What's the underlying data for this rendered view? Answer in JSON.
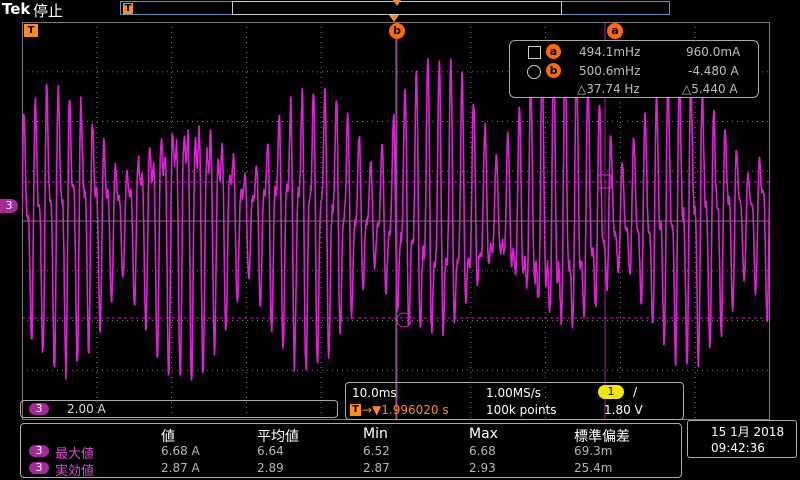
{
  "topbar": {
    "brand": "Tek",
    "state": "停止",
    "trigger_marker": "T"
  },
  "markers": {
    "trigger_T": "T",
    "cursor_a": "a",
    "cursor_b": "b",
    "channel": "3"
  },
  "cursor_readout": {
    "a_label": "a",
    "a_freq": "494.1mHz",
    "a_value": "960.0mA",
    "b_label": "b",
    "b_freq": "500.6mHz",
    "b_value": "-4.480 A",
    "delta_freq": "△37.74 Hz",
    "delta_value": "△5.440 A"
  },
  "channel_scale": {
    "channel": "3",
    "scale": "2.00 A"
  },
  "horizontal": {
    "timebase": "10.0ms",
    "sample_rate": "1.00MS/s",
    "trigger_source": "1",
    "trigger_slope": "/",
    "trigger_prefix": "T",
    "position": "→▼1.996020 s",
    "record_length": "100k points",
    "trigger_level": "1.80 V"
  },
  "measurements": {
    "headers": [
      "値",
      "平均値",
      "Min",
      "Max",
      "標準偏差"
    ],
    "rows": [
      {
        "channel": "3",
        "name": "最大値",
        "values": [
          "6.68 A",
          "6.64",
          "6.52",
          "6.68",
          "69.3m"
        ]
      },
      {
        "channel": "3",
        "name": "実効値",
        "values": [
          "2.87 A",
          "2.89",
          "2.87",
          "2.93",
          "25.4m"
        ]
      }
    ]
  },
  "datetime": {
    "date": "15 1月 2018",
    "time": "09:42:36"
  },
  "colors": {
    "trace": "#e020d8",
    "orange": "#ff8c1a",
    "grid": "#7a7a7a"
  }
}
